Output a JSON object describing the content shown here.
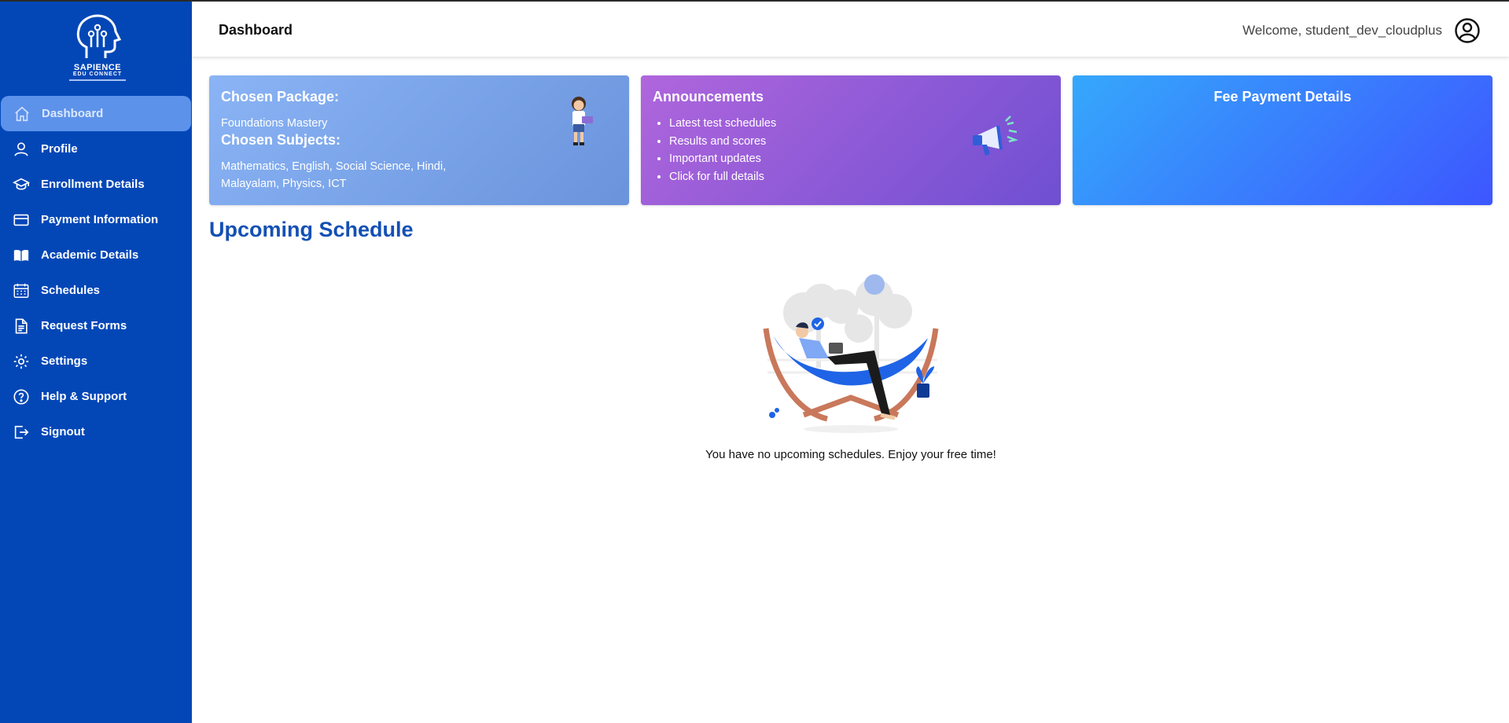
{
  "brand": {
    "line1": "SAPIENCE",
    "line2": "EDU CONNECT"
  },
  "sidebar": {
    "items": [
      {
        "label": "Dashboard",
        "icon": "home-icon",
        "active": true
      },
      {
        "label": "Profile",
        "icon": "user-icon"
      },
      {
        "label": "Enrollment Details",
        "icon": "graduation-cap-icon"
      },
      {
        "label": "Payment Information",
        "icon": "credit-card-icon"
      },
      {
        "label": "Academic Details",
        "icon": "book-icon"
      },
      {
        "label": "Schedules",
        "icon": "calendar-icon"
      },
      {
        "label": "Request Forms",
        "icon": "document-icon"
      },
      {
        "label": "Settings",
        "icon": "gear-icon"
      },
      {
        "label": "Help & Support",
        "icon": "help-circle-icon"
      },
      {
        "label": "Signout",
        "icon": "signout-icon"
      }
    ]
  },
  "header": {
    "title": "Dashboard",
    "welcome": "Welcome, student_dev_cloudplus"
  },
  "cards": {
    "package": {
      "title": "Chosen Package:",
      "package_name": "Foundations Mastery",
      "subjects_title": "Chosen Subjects:",
      "subjects_line1": "Mathematics, English, Social Science, Hindi,",
      "subjects_line2": "Malayalam, Physics, ICT"
    },
    "announcements": {
      "title": "Announcements",
      "items": [
        "Latest test schedules",
        "Results and scores",
        "Important updates",
        "Click for full details"
      ]
    },
    "fee": {
      "title": "Fee Payment Details"
    }
  },
  "schedule": {
    "title": "Upcoming Schedule",
    "empty_message": "You have no upcoming schedules. Enjoy your free time!"
  },
  "colors": {
    "sidebar": "#0347b7",
    "active_item": "#5d92ea",
    "accent_title": "#1450b4"
  }
}
